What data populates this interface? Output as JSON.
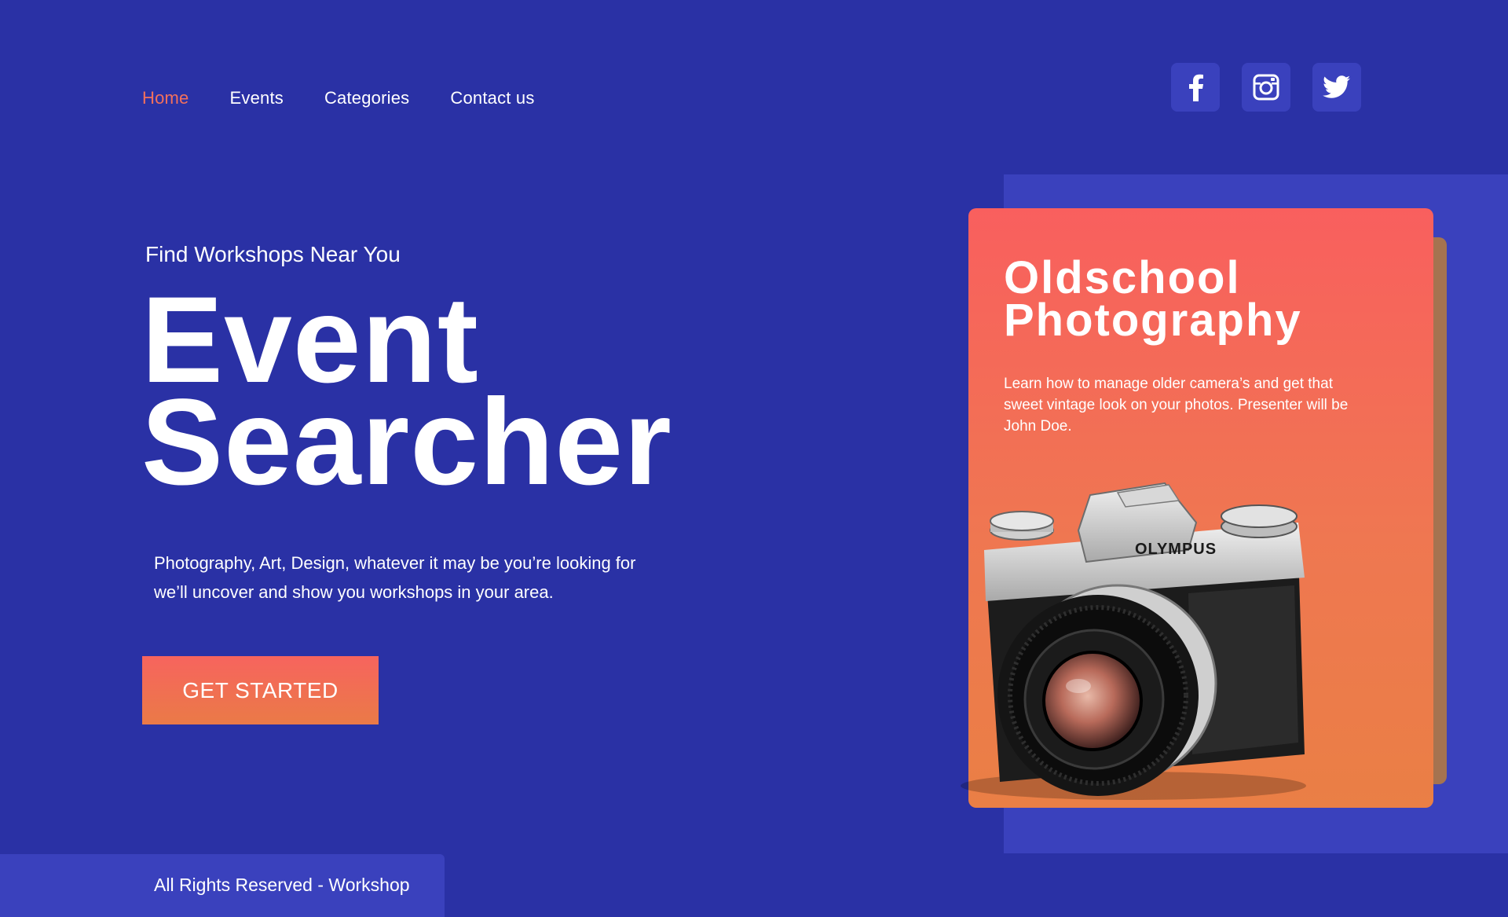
{
  "nav": {
    "items": [
      {
        "label": "Home",
        "active": true
      },
      {
        "label": "Events",
        "active": false
      },
      {
        "label": "Categories",
        "active": false
      },
      {
        "label": "Contact us",
        "active": false
      }
    ]
  },
  "socials": [
    {
      "icon": "facebook-icon"
    },
    {
      "icon": "instagram-icon"
    },
    {
      "icon": "twitter-icon"
    }
  ],
  "hero": {
    "eyebrow": "Find Workshops Near You",
    "title_line1": "Event",
    "title_line2": "Searcher",
    "description_line1": "Photography, Art, Design, whatever it may be you’re looking for",
    "description_line2": "we’ll uncover and show you workshops in your area.",
    "cta_label": "GET STARTED"
  },
  "card": {
    "title_line1": "Oldschool",
    "title_line2": "Photography",
    "description": "Learn how to manage older camera’s and get that sweet vintage look on your photos. Presenter will be John Doe.",
    "image_brand": "OLYMPUS"
  },
  "footer": {
    "text": "All Rights Reserved - Workshop"
  },
  "colors": {
    "background": "#2a31a5",
    "panel": "#3a41bd",
    "accent": "#f3705c"
  }
}
